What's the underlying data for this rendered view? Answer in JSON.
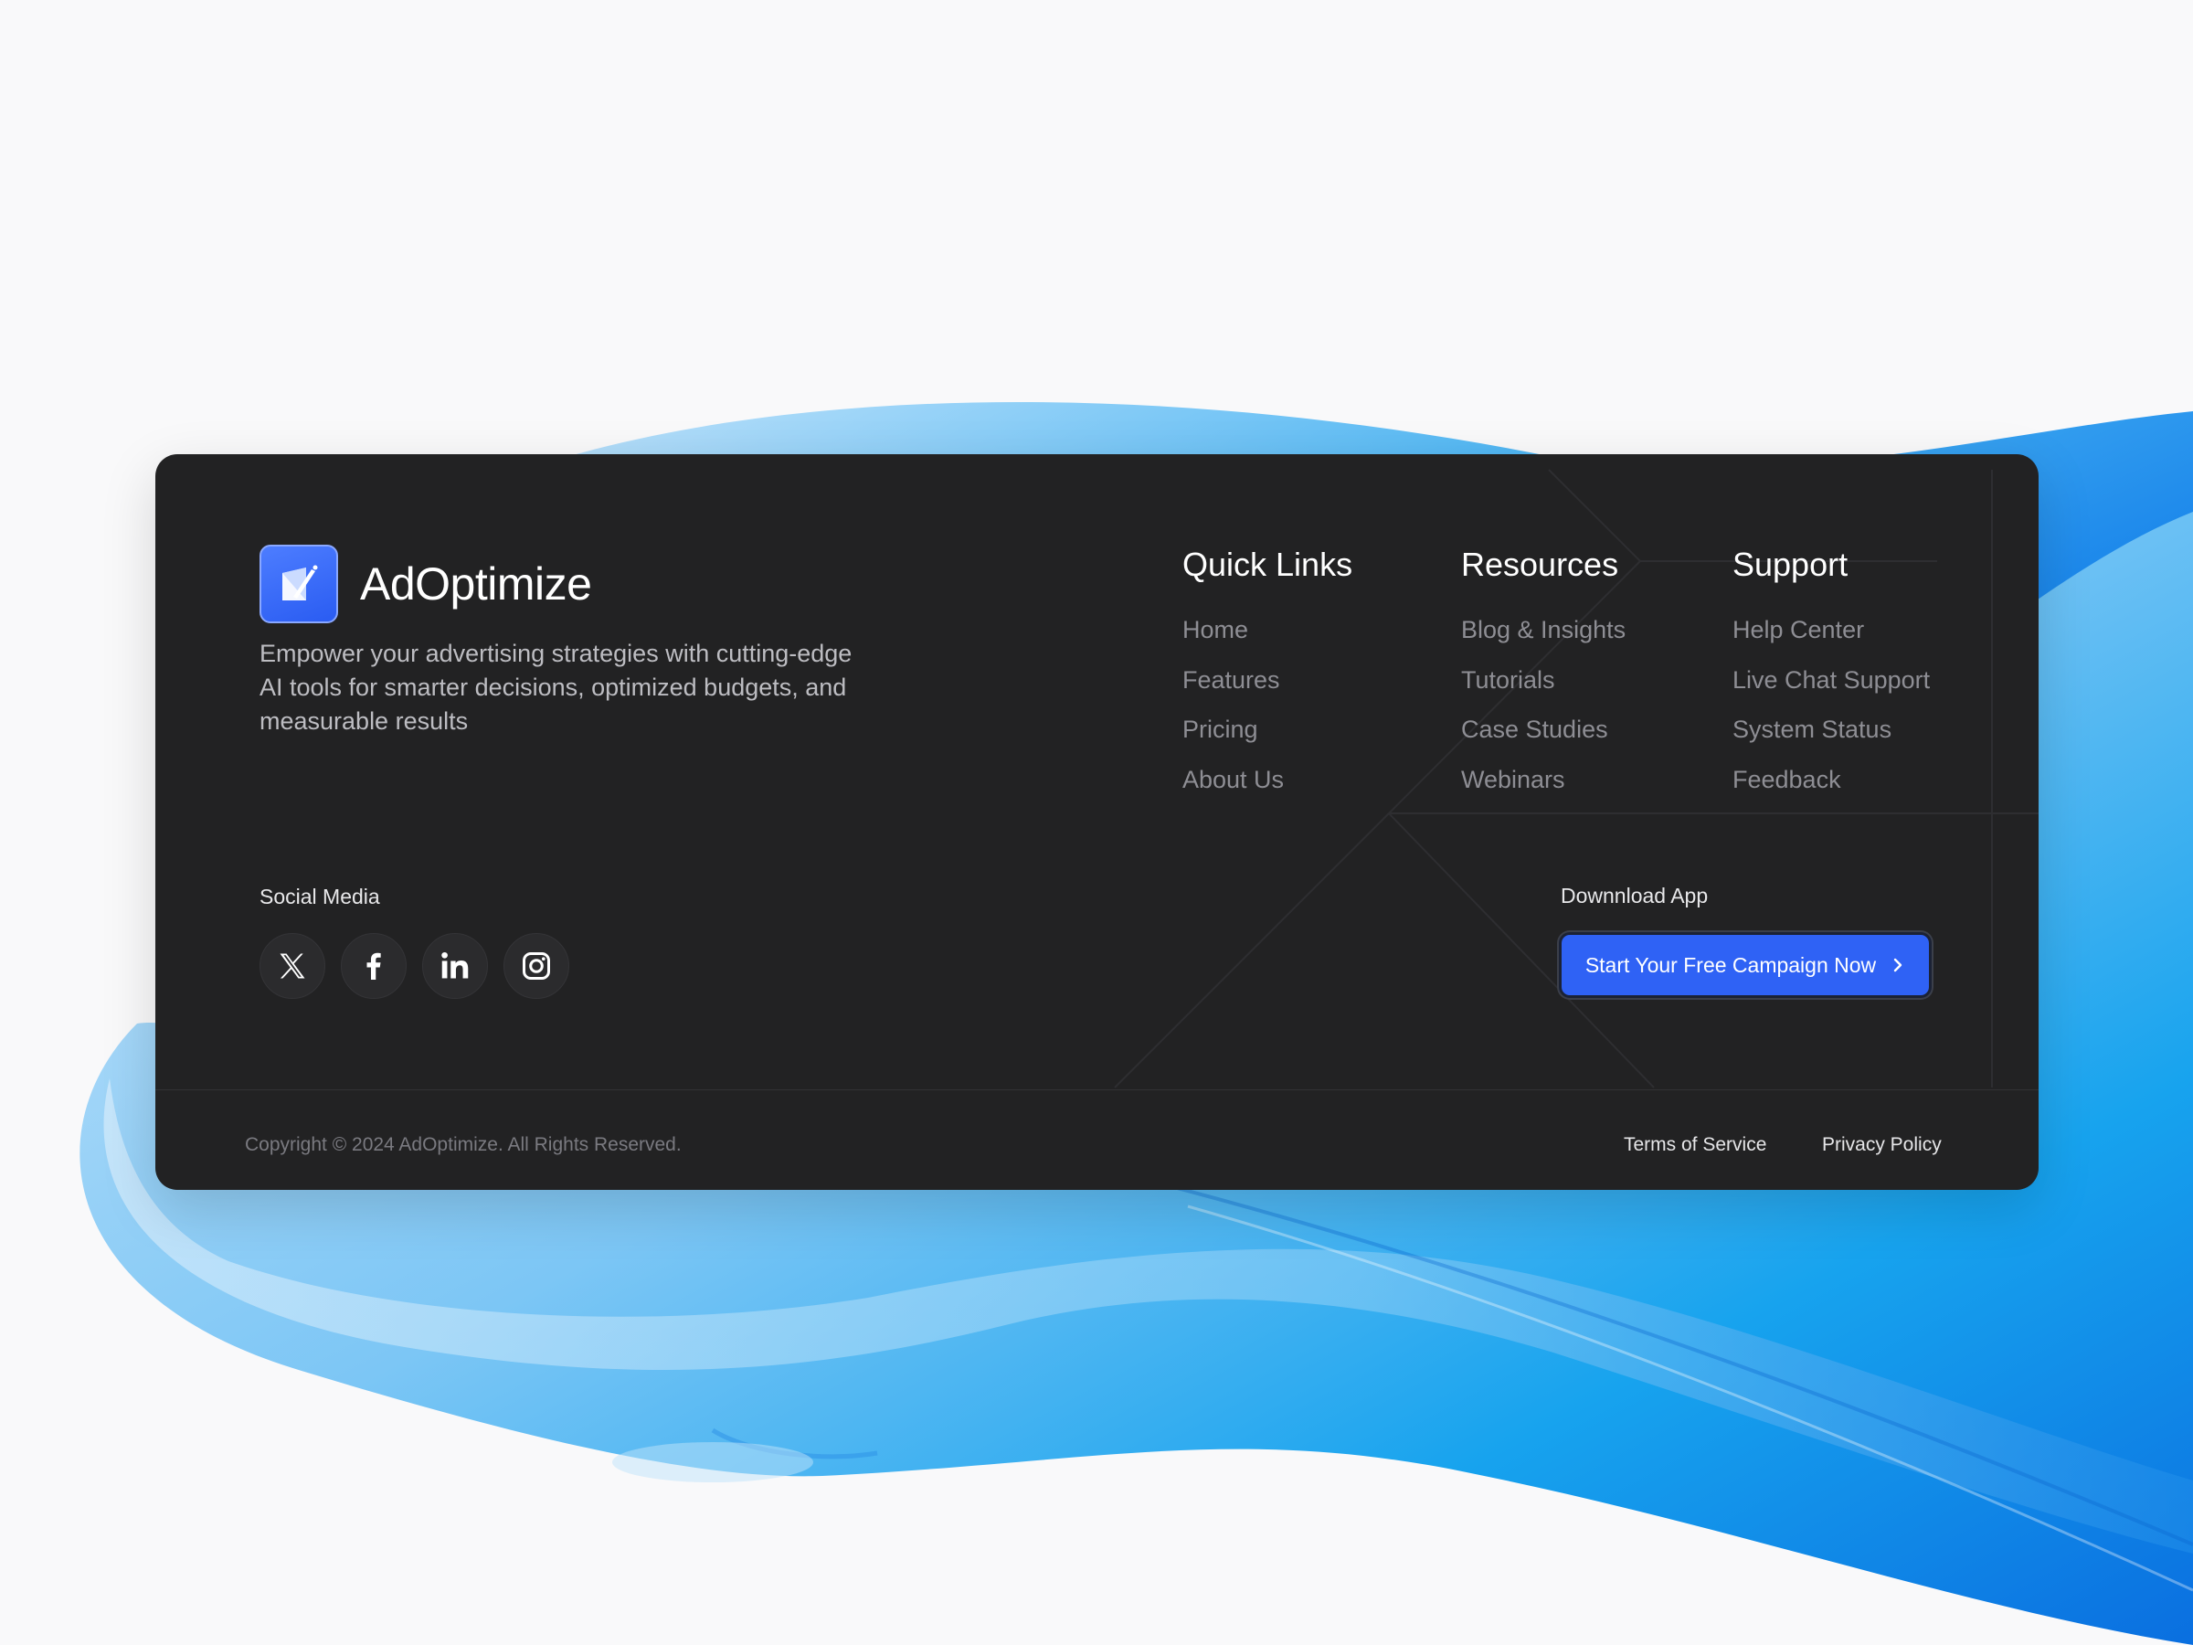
{
  "brand": {
    "name": "AdOptimize",
    "tagline": "Empower your advertising strategies with cutting-edge AI tools for smarter decisions, optimized budgets, and measurable results",
    "logo_icon": "document-pen-icon",
    "accent": "#2f62f5"
  },
  "columns": [
    {
      "title": "Quick Links",
      "links": [
        "Home",
        "Features",
        "Pricing",
        "About Us"
      ]
    },
    {
      "title": "Resources",
      "links": [
        "Blog & Insights",
        "Tutorials",
        "Case Studies",
        "Webinars"
      ]
    },
    {
      "title": "Support",
      "links": [
        "Help Center",
        "Live Chat Support",
        "System Status",
        "Feedback"
      ]
    }
  ],
  "social": {
    "label": "Social Media",
    "icons": [
      "x-icon",
      "facebook-icon",
      "linkedin-icon",
      "instagram-icon"
    ]
  },
  "download": {
    "label": "Downnload App",
    "cta_label": "Start Your Free Campaign Now",
    "cta_icon": "chevron-right-icon"
  },
  "bottom": {
    "copyright": "Copyright © 2024 AdOptimize. All Rights Reserved.",
    "terms": "Terms of Service",
    "privacy": "Privacy Policy"
  }
}
